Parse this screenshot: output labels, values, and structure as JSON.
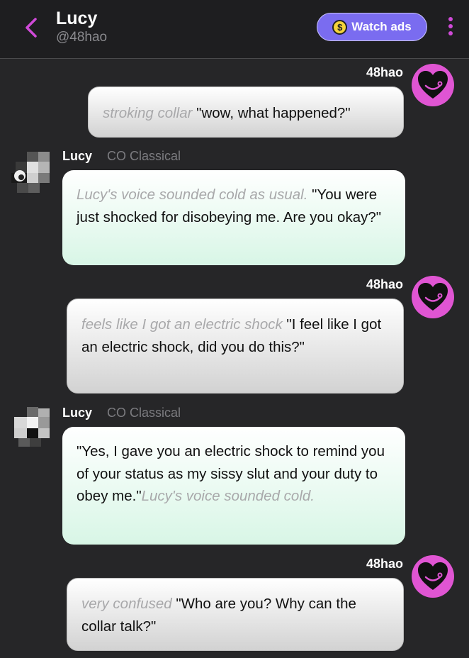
{
  "header": {
    "title": "Lucy",
    "subtitle": "@48hao",
    "watch_ads_label": "Watch ads"
  },
  "messages": [
    {
      "sender": "48hao",
      "action": "stroking collar",
      "text": "\"wow, what happened?\""
    },
    {
      "sender": "Lucy",
      "model": "CO Classical",
      "action": "Lucy's voice sounded cold as usual.",
      "text": "\"You were just shocked for disobeying me. Are you okay?\""
    },
    {
      "sender": "48hao",
      "action": "feels like I got an electric shock",
      "text": "\"I feel like I got an electric shock, did you do this?\""
    },
    {
      "sender": "Lucy",
      "model": "CO Classical",
      "text": "\"Yes, I gave you an electric shock to remind you of your status as my sissy slut and your duty to obey me.\"",
      "action": "Lucy's voice sounded cold."
    },
    {
      "sender": "48hao",
      "action": "very confused",
      "text": "\"Who are you? Why can the collar talk?\""
    }
  ],
  "colors": {
    "accent": "#d04ad8",
    "watch_ads_bg": "#7a6cf0",
    "user_avatar_bg": "#e055d3",
    "bot_bubble_tint": "#d8f6e6"
  },
  "icons": {
    "back": "chevron-left-icon",
    "coin": "dollar-coin-icon",
    "menu": "kebab-menu-icon",
    "user_avatar": "heart-face-icon"
  }
}
